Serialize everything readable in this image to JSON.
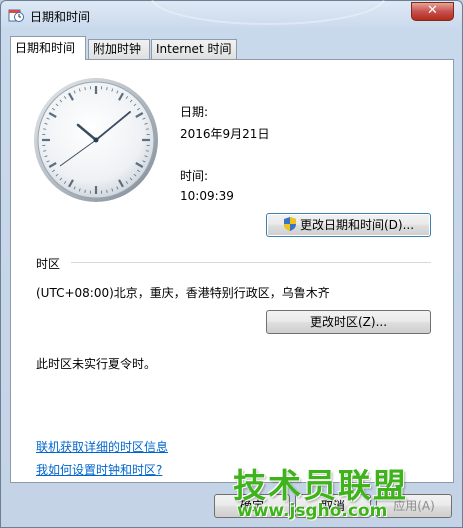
{
  "window": {
    "title": "日期和时间",
    "close_label": "✕"
  },
  "tabs": [
    {
      "label": "日期和时间",
      "active": true
    },
    {
      "label": "附加时钟",
      "active": false
    },
    {
      "label": "Internet 时间",
      "active": false
    }
  ],
  "date": {
    "label": "日期:",
    "value": "2016年9月21日"
  },
  "time": {
    "label": "时间:",
    "value": "10:09:39"
  },
  "change_datetime_button": "更改日期和时间(D)...",
  "timezone": {
    "section_label": "时区",
    "value": "(UTC+08:00)北京，重庆，香港特别行政区，乌鲁木齐",
    "change_button": "更改时区(Z)...",
    "dst_note": "此时区未实行夏令时。"
  },
  "links": {
    "timezone_info": "联机获取详细的时区信息",
    "how_to": "我如何设置时钟和时区?"
  },
  "footer": {
    "ok": "确定",
    "cancel": "取消",
    "apply": "应用(A)"
  },
  "watermark": {
    "brand": "技术员联盟",
    "url": "www.jsgho.com"
  },
  "colors": {
    "link": "#0066cc",
    "watermark": "#3fb31b",
    "close": "#c75050"
  }
}
